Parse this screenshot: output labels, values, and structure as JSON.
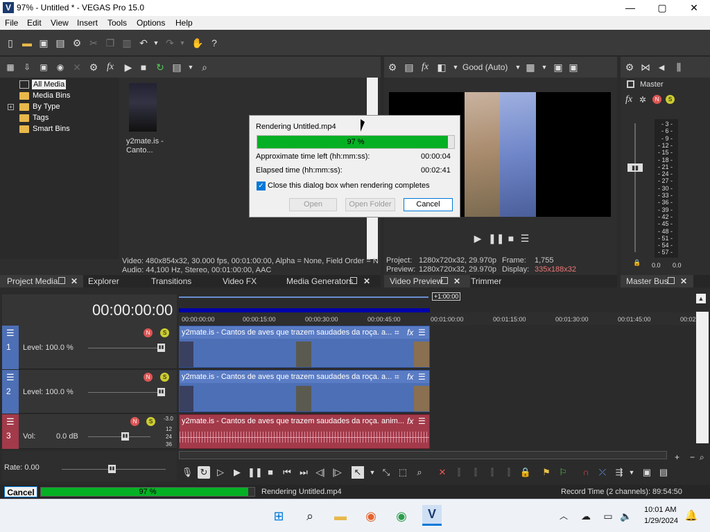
{
  "window": {
    "title": "97% - Untitled * - VEGAS Pro 15.0",
    "app_icon": "V",
    "min": "—",
    "max": "▢",
    "close": "✕"
  },
  "menu": [
    "File",
    "Edit",
    "View",
    "Insert",
    "Tools",
    "Options",
    "Help"
  ],
  "project_media": {
    "tree": [
      "All Media",
      "Media Bins",
      "By Type",
      "Tags",
      "Smart Bins"
    ],
    "thumb_label": "y2mate.is - Canto...",
    "info_video": "Video: 480x854x32, 30.000 fps, 00:01:00:00, Alpha = None, Field Order = N",
    "info_audio": "Audio: 44,100 Hz, Stereo, 00:01:00:00, AAC"
  },
  "tabs_left": [
    "Project Media",
    "Explorer",
    "Transitions",
    "Video FX",
    "Media Generators"
  ],
  "preview": {
    "quality": "Good (Auto)",
    "project_label": "Project:",
    "project_val": "1280x720x32, 29.970p",
    "frame_label": "Frame:",
    "frame_val": "1,755",
    "preview_label": "Preview:",
    "preview_val": "1280x720x32, 29.970p",
    "display_label": "Display:",
    "display_val": "335x188x32"
  },
  "tabs_mid": [
    "Video Preview",
    "Trimmer"
  ],
  "master": {
    "label": "Master",
    "scale": [
      "- 3 -",
      "- 6 -",
      "- 9 -",
      "- 12 -",
      "- 15 -",
      "- 18 -",
      "- 21 -",
      "- 24 -",
      "- 27 -",
      "- 30 -",
      "- 33 -",
      "- 36 -",
      "- 39 -",
      "- 42 -",
      "- 45 -",
      "- 48 -",
      "- 51 -",
      "- 54 -",
      "- 57 -"
    ],
    "val_l": "0.0",
    "val_r": "0.0",
    "tab": "Master Bus"
  },
  "dialog": {
    "title": "Rendering Untitled.mp4",
    "progress_pct": 97,
    "progress_text": "97 %",
    "time_left_label": "Approximate time left (hh:mm:ss):",
    "time_left": "00:00:04",
    "elapsed_label": "Elapsed time (hh:mm:ss):",
    "elapsed": "00:02:41",
    "checkbox_label": "Close this dialog box when rendering completes",
    "btn_open": "Open",
    "btn_open_folder": "Open Folder",
    "btn_cancel": "Cancel"
  },
  "timeline": {
    "timecode": "00:00:00:00",
    "marker": "+1:00:00",
    "ruler": [
      "00:00:00:00",
      "00:00:15:00",
      "00:00:30:00",
      "00:00:45:00",
      "00:01:00:00",
      "00:01:15:00",
      "00:01:30:00",
      "00:01:45:00",
      "00:02"
    ],
    "tracks": [
      {
        "num": "1",
        "level": "Level: 100.0 %",
        "clip": "y2mate.is - Cantos de aves que trazem saudades da roça. a..."
      },
      {
        "num": "2",
        "level": "Level: 100.0 %",
        "clip": "y2mate.is - Cantos de aves que trazem saudades da roça. a..."
      },
      {
        "num": "3",
        "level": "Vol:",
        "vol_val": "0.0 dB",
        "clip": "y2mate.is - Cantos de aves que trazem saudades da roça. anim...",
        "meter": [
          "-3.0",
          "12",
          "24",
          "36"
        ]
      }
    ],
    "rate": "Rate: 0.00"
  },
  "status": {
    "cancel": "Cancel",
    "progress_pct": 97,
    "progress_text": "97 %",
    "rendering": "Rendering Untitled.mp4",
    "record_time": "Record Time (2 channels): 89:54:50"
  },
  "taskbar": {
    "time": "10:01 AM",
    "date": "1/29/2024"
  },
  "colors": {
    "accent": "#0078d7",
    "progress": "#06b025",
    "video_track": "#4d6fb5",
    "audio_track": "#a33a4a"
  }
}
